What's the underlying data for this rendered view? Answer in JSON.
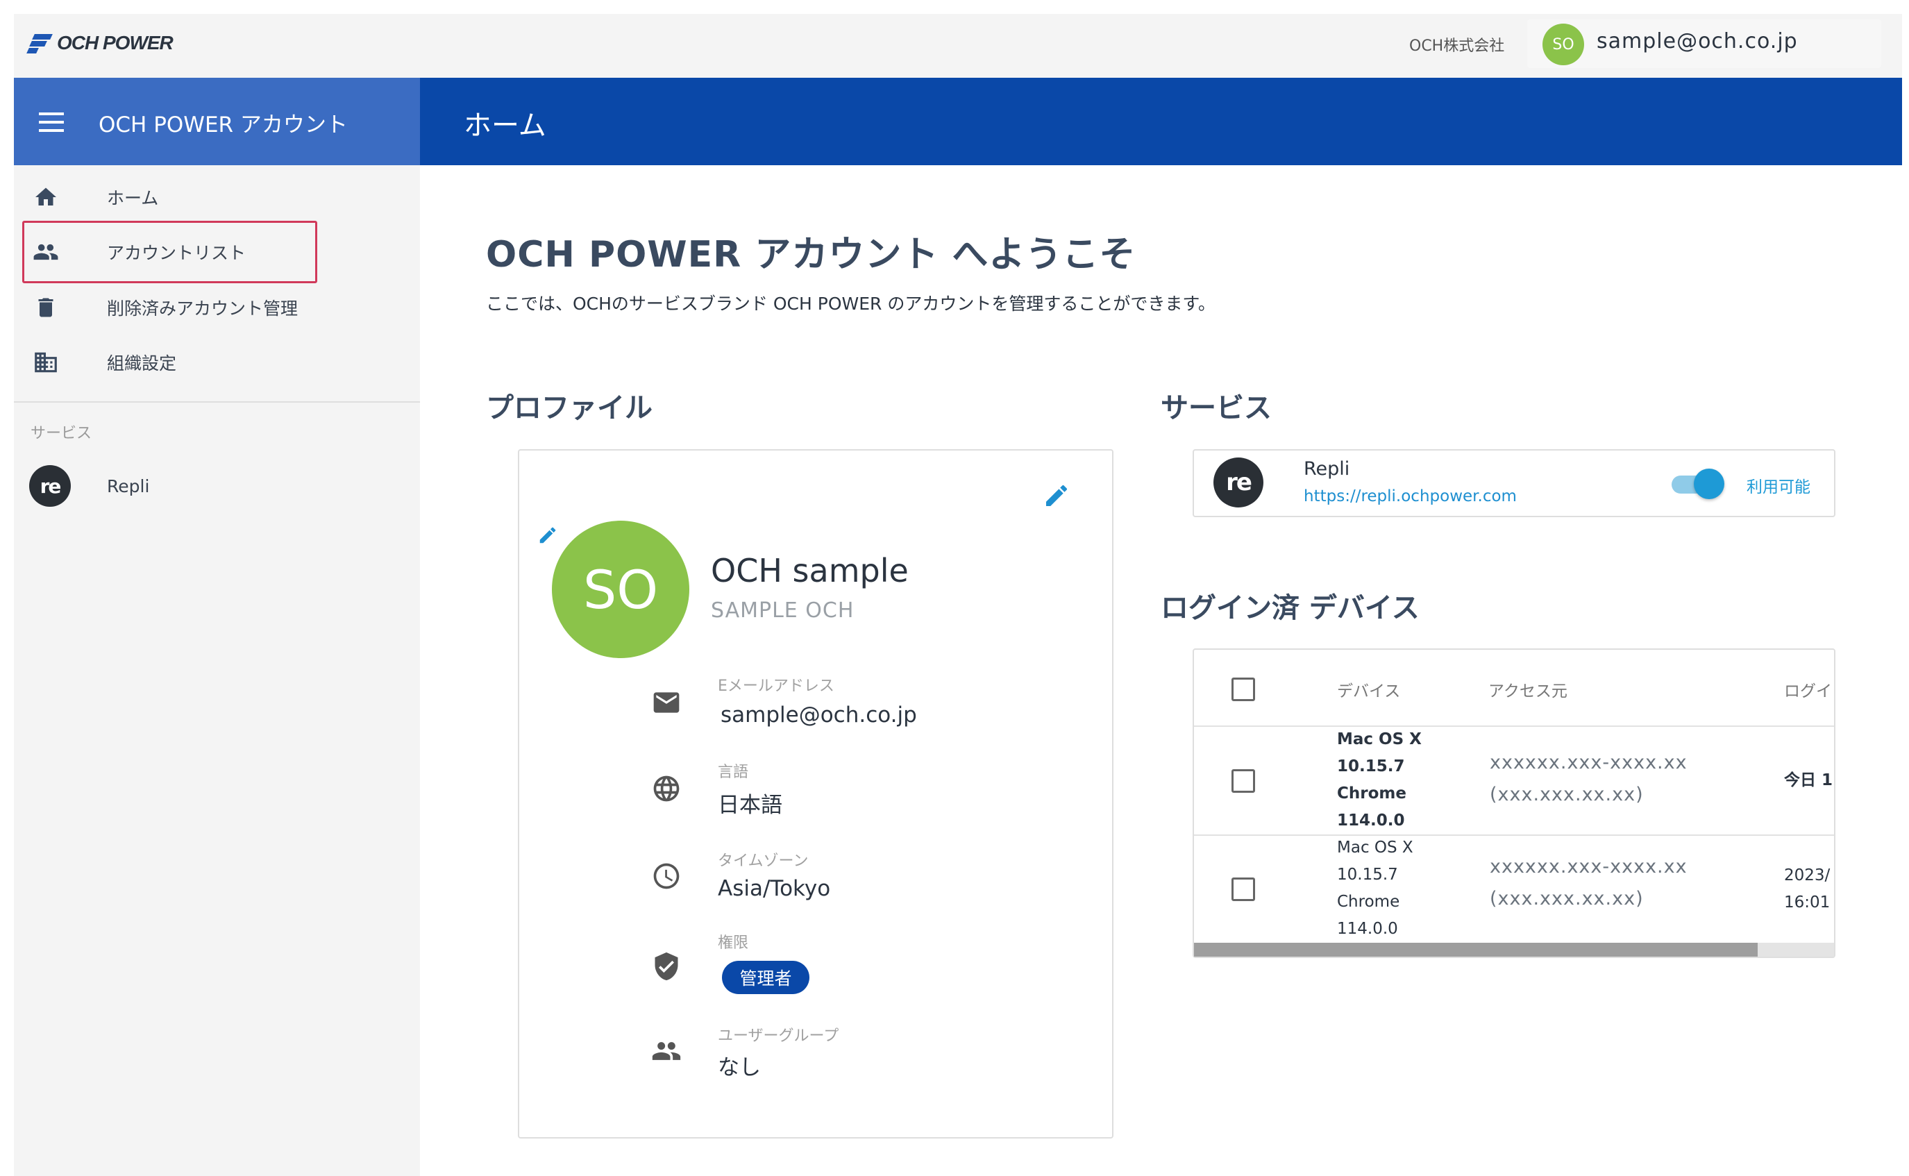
{
  "topbar": {
    "logo_text": "OCH POWER",
    "company": "OCH株式会社",
    "avatar_initials": "SO",
    "user_email": "sample@och.co.jp"
  },
  "header": {
    "app_title": "OCH POWER アカウント",
    "page_title": "ホーム"
  },
  "sidebar": {
    "items": [
      {
        "label": "ホーム",
        "icon": "home-icon"
      },
      {
        "label": "アカウントリスト",
        "icon": "people-icon"
      },
      {
        "label": "削除済みアカウント管理",
        "icon": "trash-icon"
      },
      {
        "label": "組織設定",
        "icon": "building-icon"
      }
    ],
    "services_heading": "サービス",
    "services": [
      {
        "label": "Repli",
        "logo_text": "re"
      }
    ]
  },
  "main": {
    "welcome_title": "OCH POWER アカウント へようこそ",
    "welcome_desc": "ここでは、OCHのサービスブランド OCH POWER のアカウントを管理することができます。",
    "profile_heading": "プロファイル",
    "services_heading": "サービス",
    "devices_heading": "ログイン済 デバイス"
  },
  "profile": {
    "initials": "SO",
    "name": "OCH sample",
    "name_kana": "SAMPLE OCH",
    "fields": [
      {
        "label": "Eメールアドレス",
        "value": "sample@och.co.jp",
        "icon": "mail-icon"
      },
      {
        "label": "言語",
        "value": "日本語",
        "icon": "globe-icon"
      },
      {
        "label": "タイムゾーン",
        "value": "Asia/Tokyo",
        "icon": "clock-icon"
      },
      {
        "label": "権限",
        "value": "管理者",
        "icon": "shield-check-icon"
      },
      {
        "label": "ユーザーグループ",
        "value": "なし",
        "icon": "people-icon"
      }
    ]
  },
  "service": {
    "logo_text": "re",
    "name": "Repli",
    "url": "https://repli.ochpower.com",
    "enabled": true,
    "status": "利用可能"
  },
  "devices": {
    "columns": [
      "デバイス",
      "アクセス元",
      "ログイ"
    ],
    "rows": [
      {
        "device": [
          "Mac OS X",
          "10.15.7",
          "Chrome",
          "114.0.0"
        ],
        "ip": [
          "xxxxxx.xxx-xxxx.xx",
          "(xxx.xxx.xx.xx)"
        ],
        "login": [
          "今日 1"
        ],
        "bold": true
      },
      {
        "device": [
          "Mac OS X",
          "10.15.7",
          "Chrome",
          "114.0.0"
        ],
        "ip": [
          "xxxxxx.xxx-xxxx.xx",
          "(xxx.xxx.xx.xx)"
        ],
        "login": [
          "2023/",
          "16:01"
        ],
        "bold": false
      }
    ],
    "scroll_position": 0.88
  },
  "colors": {
    "primary": "#0a48a8",
    "header_left": "#3b6cc2",
    "avatar": "#8bc34a",
    "accent": "#1e9ad6",
    "highlight": "#d0395a"
  }
}
